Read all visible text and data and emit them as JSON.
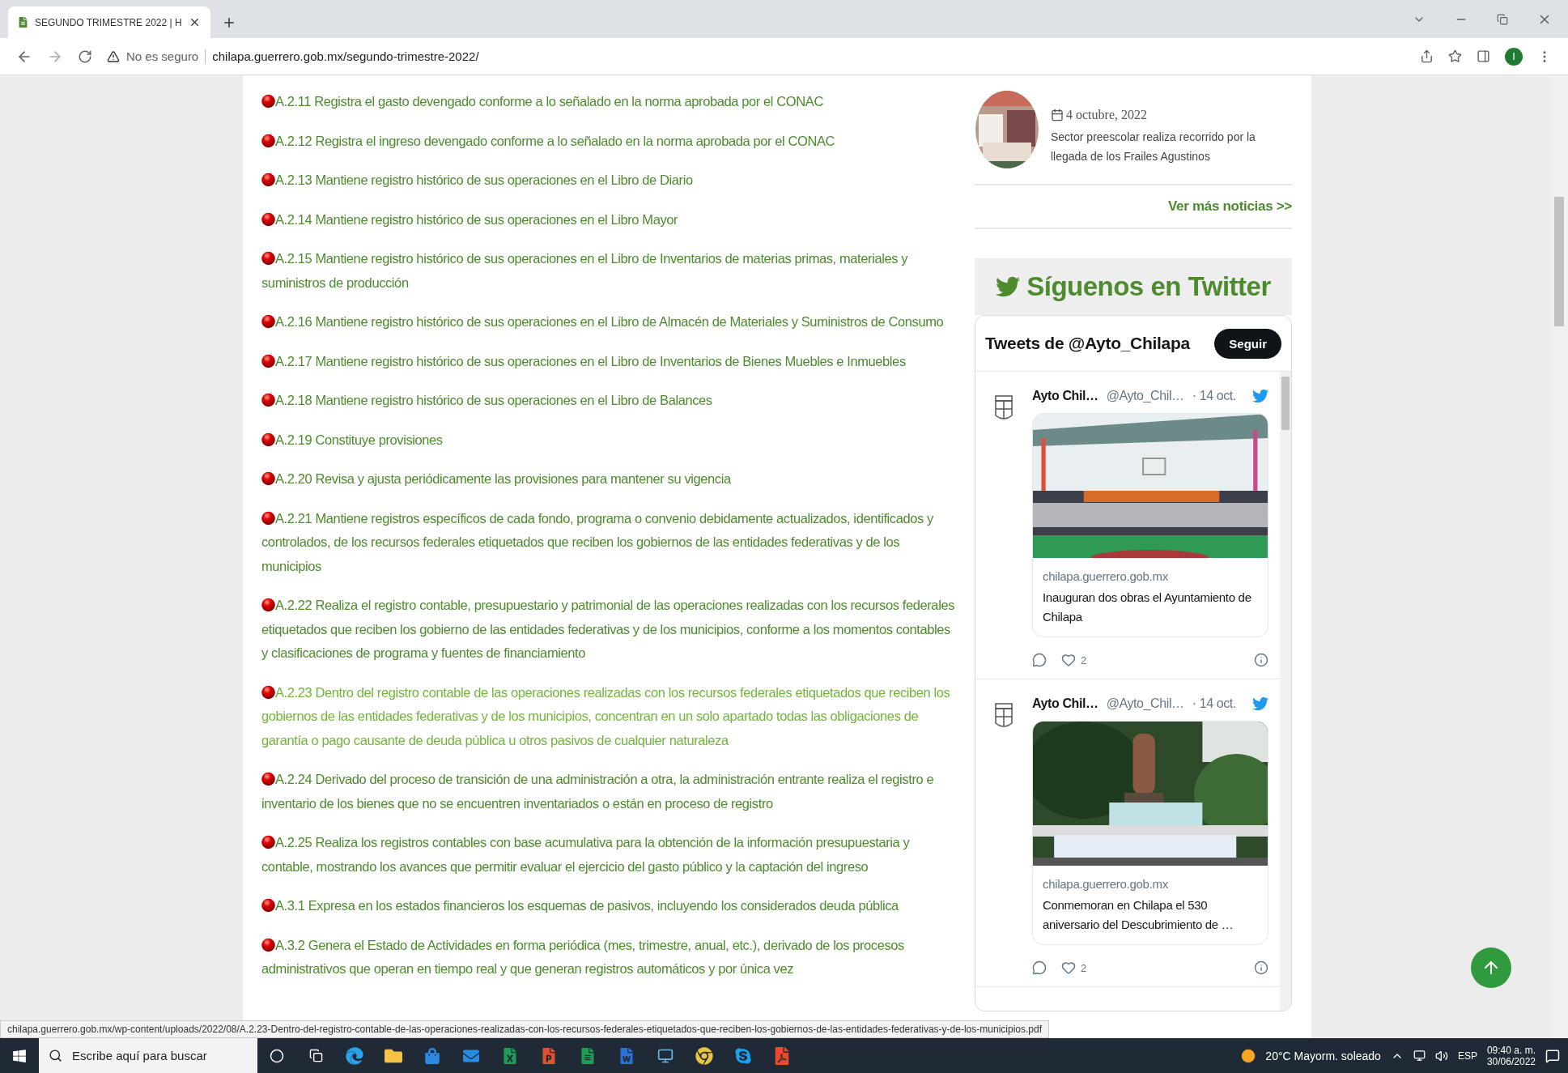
{
  "browser": {
    "tab_title": "SEGUNDO TRIMESTRE 2022 | H",
    "url_warning": "No es seguro",
    "url": "chilapa.guerrero.gob.mx/segundo-trimestre-2022/",
    "profile_initial": "I"
  },
  "items": [
    {
      "text": "A.2.11 Registra el gasto devengado conforme a lo señalado en la norma aprobada por el CONAC",
      "hovered": false
    },
    {
      "text": "A.2.12 Registra el ingreso devengado conforme a lo señalado en la norma aprobada por el CONAC",
      "hovered": false
    },
    {
      "text": "A.2.13 Mantiene registro histórico de sus operaciones en el Libro de Diario",
      "hovered": false
    },
    {
      "text": "A.2.14 Mantiene registro histórico de sus operaciones en el Libro Mayor",
      "hovered": false
    },
    {
      "text": "A.2.15 Mantiene registro histórico de sus operaciones en el Libro de Inventarios de materias primas, materiales y suministros de producción",
      "hovered": false
    },
    {
      "text": "A.2.16 Mantiene registro histórico de sus operaciones en el Libro de Almacén de Materiales y Suministros de Consumo",
      "hovered": false
    },
    {
      "text": "A.2.17 Mantiene registro histórico de sus operaciones en el Libro de Inventarios de Bienes Muebles e Inmuebles",
      "hovered": false
    },
    {
      "text": "A.2.18 Mantiene registro histórico de sus operaciones en el Libro de Balances",
      "hovered": false
    },
    {
      "text": "A.2.19 Constituye provisiones",
      "hovered": false
    },
    {
      "text": "A.2.20 Revisa y ajusta periódicamente las provisiones para mantener su vigencia",
      "hovered": false
    },
    {
      "text": "A.2.21 Mantiene registros específicos de cada fondo, programa o convenio debidamente actualizados, identificados y controlados, de los recursos federales etiquetados que reciben los gobiernos de las entidades federativas y de los municipios",
      "hovered": false
    },
    {
      "text": "A.2.22 Realiza el registro contable, presupuestario y patrimonial de las operaciones realizadas con los recursos federales etiquetados que reciben los gobierno de las entidades federativas y de los municipios, conforme a los momentos contables y clasificaciones de programa y fuentes de financiamiento",
      "hovered": false
    },
    {
      "text": "A.2.23 Dentro del registro contable de las operaciones realizadas con los recursos federales etiquetados que reciben los gobiernos de las entidades federativas y de los municipios, concentran en un solo apartado todas las obligaciones de garantía o pago causante de deuda pública u otros pasivos de cualquier naturaleza",
      "hovered": true
    },
    {
      "text": "A.2.24 Derivado del proceso de transición de una administración a otra, la administración entrante realiza el registro e inventario de los bienes que no se encuentren inventariados o están en proceso de registro",
      "hovered": false
    },
    {
      "text": "A.2.25 Realiza los registros contables con base acumulativa para la obtención de la información presupuestaria y contable, mostrando los avances que permitir evaluar el ejercicio del gasto público y la captación del ingreso",
      "hovered": false
    },
    {
      "text": "A.3.1 Expresa en los estados financieros los esquemas de pasivos, incluyendo los considerados deuda pública",
      "hovered": false
    },
    {
      "text": "A.3.2 Genera el Estado de Actividades en forma periódica (mes, trimestre, anual, etc.), derivado de los procesos administrativos que operan en tiempo real y que generan registros automáticos y por única vez",
      "hovered": false
    }
  ],
  "news": {
    "date": "4 octubre, 2022",
    "title": "Sector preescolar realiza recorrido por la llegada de los Frailes Agustinos",
    "more_link": "Ver más noticias >>"
  },
  "twitter": {
    "heading": "Síguenos en Twitter",
    "timeline_title": "Tweets de @Ayto_Chilapa",
    "follow": "Seguir",
    "tweets": [
      {
        "name": "Ayto Chil…",
        "handle": "@Ayto_Chil…",
        "date": "· 14 oct.",
        "domain": "chilapa.guerrero.gob.mx",
        "title": "Inauguran dos obras el Ayuntamiento de Chilapa",
        "likes": "2"
      },
      {
        "name": "Ayto Chil…",
        "handle": "@Ayto_Chil…",
        "date": "· 14 oct.",
        "domain": "chilapa.guerrero.gob.mx",
        "title": "Conmemoran en Chilapa el 530 aniversario del Descubrimiento de …",
        "likes": "2"
      }
    ]
  },
  "status_url": "chilapa.guerrero.gob.mx/wp-content/uploads/2022/08/A.2.23-Dentro-del-registro-contable-de-las-operaciones-realizadas-con-los-recursos-federales-etiquetados-que-reciben-los-gobiernos-de-las-entidades-federativas-y-de-los-municipios.pdf",
  "taskbar": {
    "search_placeholder": "Escribe aquí para buscar",
    "weather": "20°C Mayorm. soleado",
    "language": "ESP",
    "time": "09:40 a. m.",
    "date": "30/06/2022"
  }
}
